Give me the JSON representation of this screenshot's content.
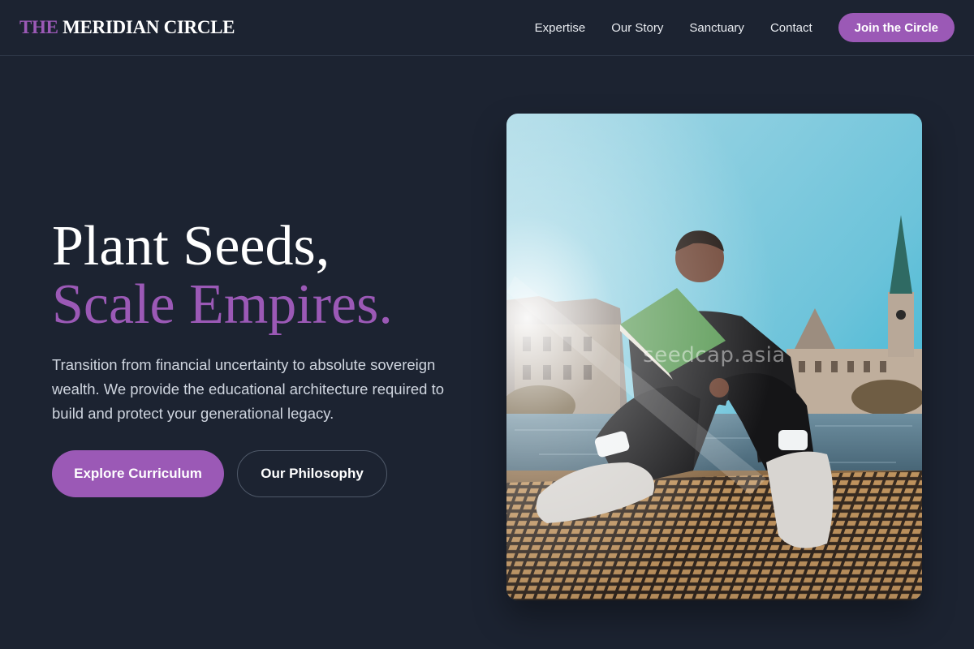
{
  "brand": {
    "logo_accent": "THE",
    "logo_rest": "MERIDIAN CIRCLE",
    "accent_color": "#9b59b6",
    "background_color": "#1c2331"
  },
  "nav": {
    "items": [
      {
        "label": "Expertise"
      },
      {
        "label": "Our Story"
      },
      {
        "label": "Sanctuary"
      },
      {
        "label": "Contact"
      }
    ],
    "cta_label": "Join the Circle"
  },
  "hero": {
    "title_line1": "Plant Seeds,",
    "title_line2": "Scale Empires.",
    "description": "Transition from financial uncertainty to absolute sovereign wealth. We provide the educational architecture required to build and protect your generational legacy.",
    "primary_button": "Explore Curriculum",
    "secondary_button": "Our Philosophy"
  },
  "image": {
    "watermark": "seedcap.asia",
    "subject": "man-reading-book-by-river-photo"
  }
}
